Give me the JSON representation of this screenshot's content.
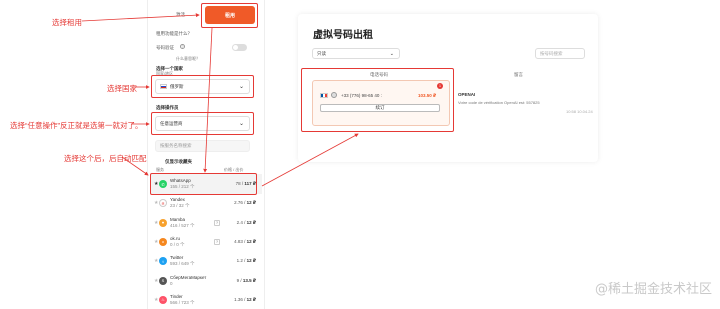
{
  "annotations": {
    "select_rent": "选择租用",
    "select_country": "选择国家",
    "select_any_op": "选择“任意操作”反正就是选第一就对了。",
    "select_service": "选择这个后，后自动匹配"
  },
  "sidebar": {
    "tab_inactive": "激活",
    "tab_active": "租用",
    "what_is_rent": "租用功能是什么？",
    "number_verify": "号码验证",
    "what_is_verify": "什么意思呢？",
    "select_country_label": "选择一个国家",
    "country_hint": "国家/地区",
    "country_value": "俄罗斯",
    "select_operator_label": "选择操作员",
    "operator_value": "任意运营商",
    "search_placeholder": "按服务名称搜索",
    "service_list_title": "仅显示收藏夹",
    "col_service": "服务",
    "col_price": "价格 / 出价",
    "services": [
      {
        "name": "WhatsApp",
        "count": "155 / 212 个",
        "price": "78 / ",
        "price_bold": "117 ₽",
        "icon": "whatsapp-icon",
        "color": "#25d366",
        "glyph": "✆",
        "starred": true,
        "q": ""
      },
      {
        "name": "Yandex",
        "count": "23 / 32 个",
        "price": "2.76 / ",
        "price_bold": "12 ₽",
        "icon": "yandex-icon",
        "color": "#ffffff",
        "glyph": "Я",
        "starred": false,
        "q": ""
      },
      {
        "name": "Mamba",
        "count": "416 / 527 个",
        "price": "2.4 / ",
        "price_bold": "12 ₽",
        "icon": "mamba-icon",
        "color": "#f7a12d",
        "glyph": "♥",
        "starred": false,
        "q": "?"
      },
      {
        "name": "ok.ru",
        "count": "0 / 0 个",
        "price": "4.83 / ",
        "price_bold": "12 ₽",
        "icon": "okru-icon",
        "color": "#f5871f",
        "glyph": "o",
        "starred": false,
        "q": "?"
      },
      {
        "name": "Twitter",
        "count": "593 / 649 个",
        "price": "1.2 / ",
        "price_bold": "12 ₽",
        "icon": "twitter-icon",
        "color": "#1da1f2",
        "glyph": "t",
        "starred": false,
        "q": ""
      },
      {
        "name": "СберМегаМаркет",
        "count": "0",
        "price": "9 / ",
        "price_bold": "13.5 ₽",
        "icon": "sber-icon",
        "color": "#555555",
        "glyph": "S",
        "starred": false,
        "q": ""
      },
      {
        "name": "Tinder",
        "count": "566 / 723 个",
        "price": "1.36 / ",
        "price_bold": "12 ₽",
        "icon": "tinder-icon",
        "color": "#fe5268",
        "glyph": "♨",
        "starred": false,
        "q": ""
      }
    ]
  },
  "main": {
    "title": "虚拟号码出租",
    "filter_value": "只读",
    "search_placeholder": "按号码搜索",
    "col_phone": "电话号码",
    "col_message": "留言",
    "phone_number": "+33 (776) 98-65 40 :",
    "phone_price": "103.50 ₽",
    "renew_button": "续订",
    "badge_count": "1",
    "message_sender": "OPENAI",
    "message_text": "Votre code de vérification OpenAI est: 557825",
    "message_time": "10:58 10.04.24"
  },
  "watermark": "@稀土掘金技术社区"
}
